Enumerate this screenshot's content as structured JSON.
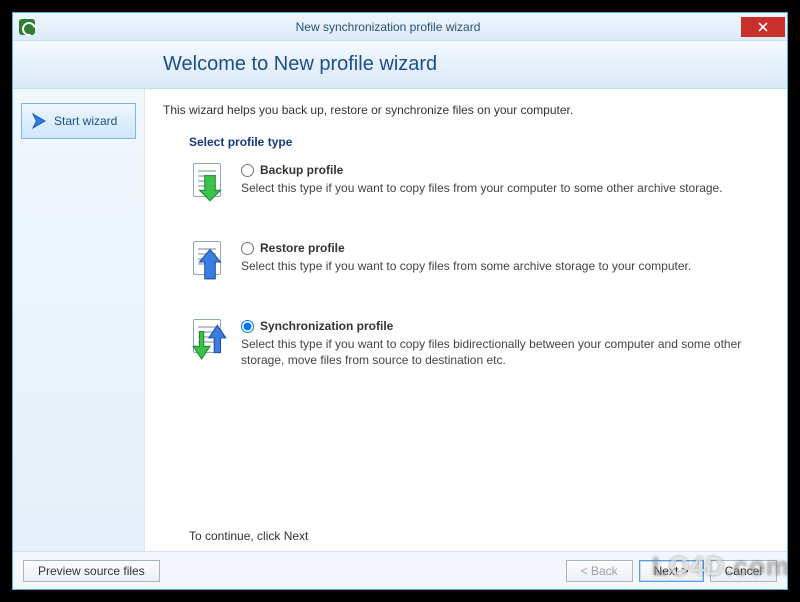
{
  "window": {
    "title": "New synchronization profile wizard"
  },
  "header": {
    "heading": "Welcome to New profile wizard"
  },
  "sidebar": {
    "start_label": "Start wizard"
  },
  "main": {
    "intro": "This wizard helps you back up, restore or synchronize files on your computer.",
    "section_title": "Select profile type",
    "options": [
      {
        "id": "backup",
        "label": "Backup profile",
        "desc": "Select this type if you want to copy files from your computer to some other archive storage.",
        "selected": false,
        "icon": "backup-icon"
      },
      {
        "id": "restore",
        "label": "Restore profile",
        "desc": "Select this type if you want to copy files from some archive storage to your computer.",
        "selected": false,
        "icon": "restore-icon"
      },
      {
        "id": "sync",
        "label": "Synchronization profile",
        "desc": "Select this type if you want to copy files bidirectionally between your computer and some other storage, move files from source to destination etc.",
        "selected": true,
        "icon": "sync-icon"
      }
    ],
    "continue_hint": "To continue, click Next"
  },
  "footer": {
    "preview": "Preview source files",
    "back": "< Back",
    "next": "Next >",
    "cancel": "Cancel"
  },
  "watermark": "LO4D.com"
}
